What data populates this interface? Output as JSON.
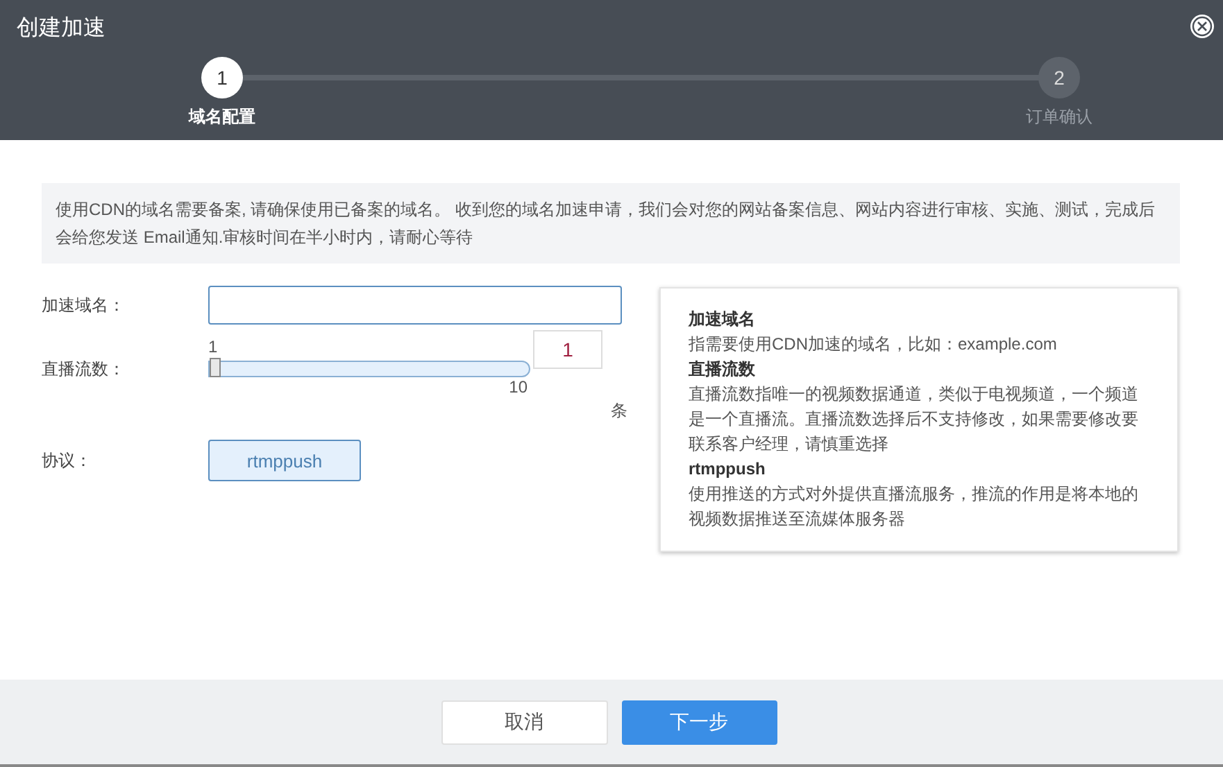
{
  "window": {
    "title": "创建加速"
  },
  "steps": [
    {
      "number": "1",
      "label": "域名配置",
      "selected": true
    },
    {
      "number": "2",
      "label": "订单确认",
      "selected": false
    }
  ],
  "notice": "使用CDN的域名需要备案, 请确保使用已备案的域名。 收到您的域名加速申请，我们会对您的网站备案信息、网站内容进行审核、实施、测试，完成后会给您发送 Email通知.审核时间在半小时内，请耐心等待",
  "form": {
    "domain": {
      "label": "加速域名："
    },
    "streams": {
      "label": "直播流数：",
      "min": "1",
      "max": "10",
      "level": 0,
      "value": "1",
      "unit": "条"
    },
    "protocol": {
      "label": "协议：",
      "options": [
        {
          "label": "rtmppush",
          "selected": true
        }
      ]
    }
  },
  "help": [
    {
      "kind": "heading",
      "text": "加速域名"
    },
    {
      "kind": "body",
      "text": "指需要使用CDN加速的域名，比如：example.com"
    },
    {
      "kind": "heading",
      "text": "直播流数"
    },
    {
      "kind": "body",
      "text": "直播流数指唯一的视频数据通道，类似于电视频道，一个频道是一个直播流。直播流数选择后不支持修改，如果需要修改要联系客户经理，请慎重选择"
    },
    {
      "kind": "heading",
      "text": "rtmppush"
    },
    {
      "kind": "body",
      "text": "使用推送的方式对外提供直播流服务，推流的作用是将本地的视频数据推送至流媒体服务器"
    }
  ],
  "buttons": [
    {
      "label": "取消",
      "kind": "secondary"
    },
    {
      "label": "下一步",
      "kind": "primary"
    }
  ]
}
